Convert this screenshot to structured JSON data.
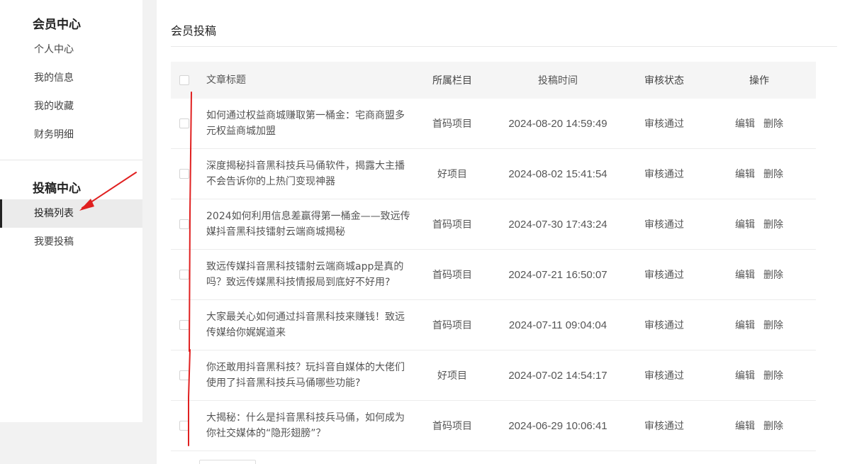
{
  "sidebar": {
    "member_center": {
      "title": "会员中心",
      "items": [
        {
          "label": "个人中心"
        },
        {
          "label": "我的信息"
        },
        {
          "label": "我的收藏"
        },
        {
          "label": "财务明细"
        }
      ]
    },
    "submission_center": {
      "title": "投稿中心",
      "items": [
        {
          "label": "投稿列表",
          "active": true
        },
        {
          "label": "我要投稿"
        }
      ]
    }
  },
  "main": {
    "title": "会员投稿",
    "table": {
      "headers": {
        "title": "文章标题",
        "category": "所属栏目",
        "time": "投稿时间",
        "status": "审核状态",
        "ops": "操作"
      },
      "rows": [
        {
          "title": "如何通过权益商城赚取第一桶金：宅商商盟多元权益商城加盟",
          "category": "首码项目",
          "time": "2024-08-20 14:59:49",
          "status": "审核通过",
          "edit": "编辑",
          "delete": "删除"
        },
        {
          "title": "深度揭秘抖音黑科技兵马俑软件，揭露大主播不会告诉你的上热门变现神器",
          "category": "好项目",
          "time": "2024-08-02 15:41:54",
          "status": "审核通过",
          "edit": "编辑",
          "delete": "删除"
        },
        {
          "title": "2024如何利用信息差赢得第一桶金——致远传媒抖音黑科技镭射云端商城揭秘",
          "category": "首码项目",
          "time": "2024-07-30 17:43:24",
          "status": "审核通过",
          "edit": "编辑",
          "delete": "删除"
        },
        {
          "title": "致远传媒抖音黑科技镭射云端商城app是真的吗？致远传媒黑科技情报局到底好不好用?",
          "category": "首码项目",
          "time": "2024-07-21 16:50:07",
          "status": "审核通过",
          "edit": "编辑",
          "delete": "删除"
        },
        {
          "title": "大家最关心如何通过抖音黑科技来赚钱！致远传媒给你娓娓道来",
          "category": "首码项目",
          "time": "2024-07-11 09:04:04",
          "status": "审核通过",
          "edit": "编辑",
          "delete": "删除"
        },
        {
          "title": "你还敢用抖音黑科技？玩抖音自媒体的大佬们使用了抖音黑科技兵马俑哪些功能?",
          "category": "好项目",
          "time": "2024-07-02 14:54:17",
          "status": "审核通过",
          "edit": "编辑",
          "delete": "删除"
        },
        {
          "title": "大揭秘：什么是抖音黑科技兵马俑，如何成为你社交媒体的“隐形翅膀”？",
          "category": "首码项目",
          "time": "2024-06-29 10:06:41",
          "status": "审核通过",
          "edit": "编辑",
          "delete": "删除"
        }
      ]
    }
  },
  "colors": {
    "annotation": "#e02020",
    "page_bg": "#f2f2f2",
    "header_bg": "#f5f5f5",
    "active_bg": "#ebebeb"
  }
}
